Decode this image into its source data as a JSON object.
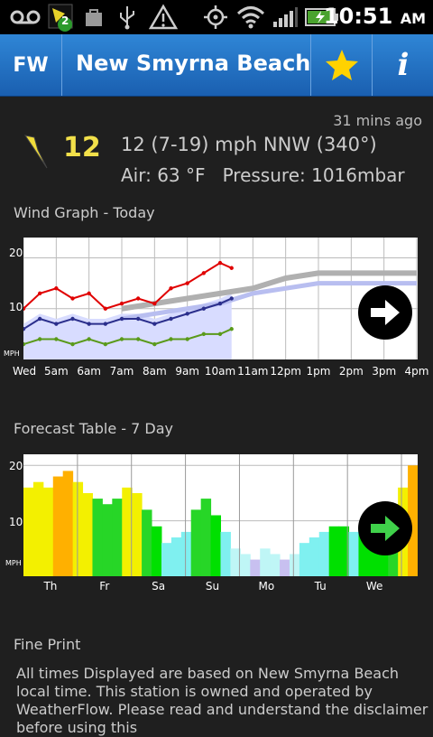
{
  "status": {
    "notification_count": "2",
    "time": "10:51",
    "ampm": "AM"
  },
  "appbar": {
    "logo": "FW",
    "title": "New Smyrna Beach",
    "favorite_icon": "star-icon",
    "info_icon": "info-icon",
    "star_color": "#ffd200"
  },
  "current": {
    "updated": "31 mins ago",
    "speed": "12",
    "summary": "12 (7-19) mph NNW (340°)",
    "air": "Air: 63 °F",
    "pressure": "Pressure: 1016mbar"
  },
  "wind_graph": {
    "title": "Wind Graph - Today",
    "y_ticks": [
      "20",
      "10"
    ],
    "unit": "MPH",
    "x_ticks": [
      "Wed",
      "5am",
      "6am",
      "7am",
      "8am",
      "9am",
      "10am",
      "11am",
      "12pm",
      "1pm",
      "2pm",
      "3pm",
      "4pm"
    ],
    "colors": {
      "gust": "#e00000",
      "average": "#2b2f8c",
      "lull": "#5a9a1a",
      "forecast_gust": "#b0b0b0",
      "forecast_avg": "#b8bef0",
      "shade": "#d8dcff"
    }
  },
  "forecast_table": {
    "title": "Forecast Table - 7 Day",
    "y_ticks": [
      "20",
      "10"
    ],
    "unit": "MPH",
    "day_ticks": [
      "Th",
      "Fr",
      "Sa",
      "Su",
      "Mo",
      "Tu",
      "We"
    ]
  },
  "fine_print": {
    "title": "Fine Print",
    "text": "All times Displayed are based on New Smyrna Beach local time. This station is owned and operated by WeatherFlow. Please read and understand the disclaimer before using this"
  },
  "chart_data": [
    {
      "type": "line",
      "title": "Wind Graph - Today",
      "ylabel": "MPH",
      "categories": [
        "Wed",
        "5am",
        "6am",
        "7am",
        "8am",
        "9am",
        "10am",
        "11am",
        "12pm",
        "1pm",
        "2pm",
        "3pm",
        "4pm"
      ],
      "ylim": [
        0,
        24
      ],
      "series": [
        {
          "name": "gust",
          "x": [
            4.0,
            4.5,
            5.0,
            5.5,
            6.0,
            6.5,
            7.0,
            7.5,
            8.0,
            8.5,
            9.0,
            9.5,
            10.0,
            10.35
          ],
          "values": [
            10,
            13,
            14,
            12,
            13,
            10,
            11,
            12,
            11,
            14,
            15,
            17,
            19,
            18
          ]
        },
        {
          "name": "average",
          "x": [
            4.0,
            4.5,
            5.0,
            5.5,
            6.0,
            6.5,
            7.0,
            7.5,
            8.0,
            8.5,
            9.0,
            9.5,
            10.0,
            10.35
          ],
          "values": [
            6,
            8,
            7,
            8,
            7,
            7,
            8,
            8,
            7,
            8,
            9,
            10,
            11,
            12
          ]
        },
        {
          "name": "lull",
          "x": [
            4.0,
            4.5,
            5.0,
            5.5,
            6.0,
            6.5,
            7.0,
            7.5,
            8.0,
            8.5,
            9.0,
            9.5,
            10.0,
            10.35
          ],
          "values": [
            3,
            4,
            4,
            3,
            4,
            3,
            4,
            4,
            3,
            4,
            4,
            5,
            5,
            6
          ]
        },
        {
          "name": "forecast gust",
          "x": [
            7.0,
            8.0,
            9.0,
            10.0,
            11.0,
            12.0,
            13.0,
            14.0,
            15.0,
            16.0
          ],
          "values": [
            10,
            11,
            12,
            13,
            14,
            16,
            17,
            17,
            17,
            17
          ]
        },
        {
          "name": "forecast average",
          "x": [
            7.0,
            8.0,
            9.0,
            10.0,
            11.0,
            12.0,
            13.0,
            14.0,
            15.0,
            16.0
          ],
          "values": [
            8,
            9,
            10,
            11,
            13,
            14,
            15,
            15,
            15,
            15
          ]
        }
      ]
    },
    {
      "type": "bar",
      "title": "Forecast Table - 7 Day",
      "ylabel": "MPH",
      "categories": [
        "Th",
        "Fr",
        "Sa",
        "Su",
        "Mo",
        "Tu",
        "We"
      ],
      "ylim": [
        0,
        22
      ],
      "values": [
        16,
        17,
        16,
        18,
        19,
        17,
        15,
        14,
        13,
        14,
        16,
        15,
        12,
        9,
        6,
        7,
        8,
        12,
        14,
        11,
        8,
        5,
        4,
        3,
        5,
        4,
        3,
        4,
        6,
        7,
        8,
        9,
        9,
        8,
        9,
        10,
        11,
        13,
        16,
        20
      ]
    }
  ]
}
